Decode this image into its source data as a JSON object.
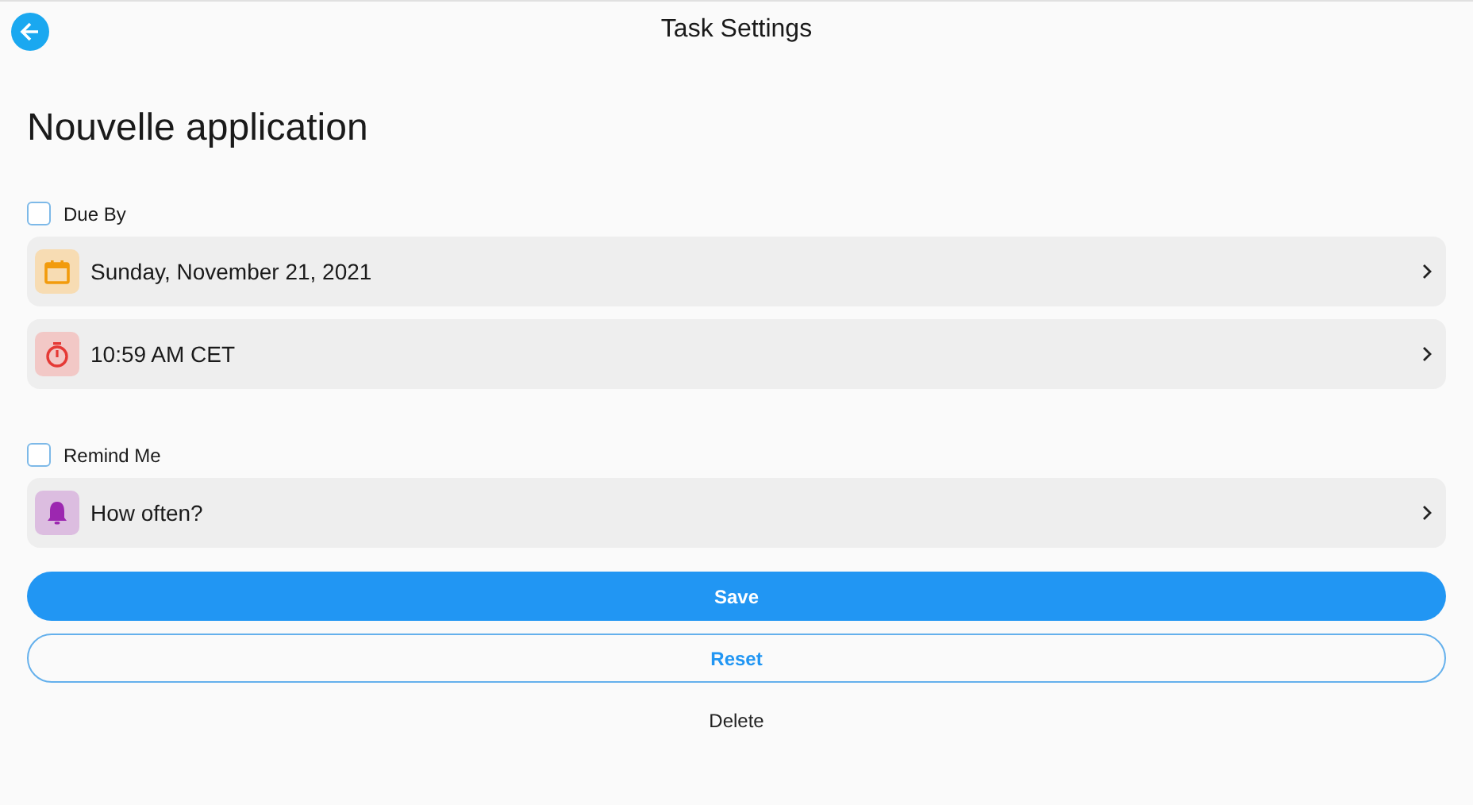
{
  "header": {
    "title": "Task Settings"
  },
  "task_name": "Nouvelle application",
  "sections": [
    {
      "label": "Due By",
      "checked": false,
      "rows": [
        {
          "kind": "calendar",
          "text": "Sunday, November 21, 2021"
        },
        {
          "kind": "timer",
          "text": "10:59 AM CET"
        }
      ]
    },
    {
      "label": "Remind Me",
      "checked": false,
      "rows": [
        {
          "kind": "bell",
          "text": "How often?"
        }
      ]
    }
  ],
  "buttons": [
    {
      "kind": "filled",
      "label": "Save"
    },
    {
      "kind": "outlined",
      "label": "Reset"
    },
    {
      "kind": "text",
      "label": "Delete"
    }
  ]
}
